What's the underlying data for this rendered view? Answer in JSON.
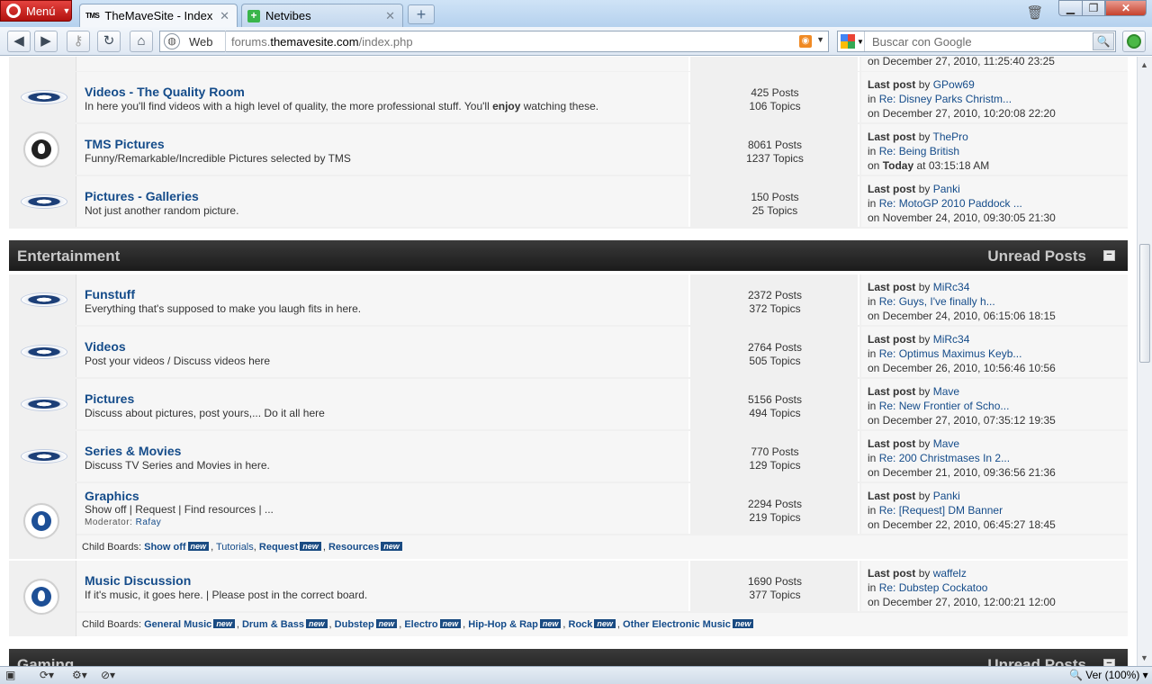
{
  "browser": {
    "menu_label": "Menú",
    "tabs": [
      {
        "title": "TheMaveSite - Index",
        "favicon": "TMS"
      },
      {
        "title": "Netvibes",
        "favicon": "+"
      }
    ],
    "address": {
      "mode_label": "Web",
      "url_prefix": "forums.",
      "url_domain": "themavesite.com",
      "url_path": "/index.php"
    },
    "search": {
      "placeholder": "Buscar con Google"
    },
    "status": {
      "zoom": "Ver (100%)"
    }
  },
  "top_partial_last": "on December 27, 2010, 11:25:40 23:25",
  "boards_media": [
    {
      "icon": "eye",
      "title": "Videos - The Quality Room",
      "desc_pre": "In here you'll find videos with a high level of quality, the more professional stuff. You'll ",
      "desc_bold": "enjoy",
      "desc_post": " watching these.",
      "posts": "425 Posts",
      "topics": "106 Topics",
      "by": "GPow69",
      "in": "Re: Disney Parks Christm...",
      "on": "on December 27, 2010, 10:20:08 22:20"
    },
    {
      "icon": "flame",
      "title": "TMS Pictures",
      "desc": "Funny/Remarkable/Incredible Pictures selected by TMS",
      "posts": "8061 Posts",
      "topics": "1237 Topics",
      "by": "ThePro",
      "in": "Re: Being British",
      "on_pre": "on ",
      "on_bold": "Today",
      "on_post": " at 03:15:18 AM"
    },
    {
      "icon": "eye",
      "title": "Pictures - Galleries",
      "desc": "Not just another random picture.",
      "posts": "150 Posts",
      "topics": "25 Topics",
      "by": "Panki",
      "in": "Re: MotoGP 2010 Paddock ...",
      "on": "on November 24, 2010, 09:30:05 21:30"
    }
  ],
  "category_entertainment": {
    "title": "Entertainment",
    "unread": "Unread Posts",
    "collapse": "−"
  },
  "boards_ent": [
    {
      "title": "Funstuff",
      "desc": "Everything that's supposed to make you laugh fits in here.",
      "posts": "2372 Posts",
      "topics": "372 Topics",
      "by": "MiRc34",
      "in": "Re: Guys, I've finally h...",
      "on": "on December 24, 2010, 06:15:06 18:15"
    },
    {
      "title": "Videos",
      "desc": "Post your videos / Discuss videos here",
      "posts": "2764 Posts",
      "topics": "505 Topics",
      "by": "MiRc34",
      "in": "Re: Optimus Maximus Keyb...",
      "on": "on December 26, 2010, 10:56:46 10:56"
    },
    {
      "title": "Pictures",
      "desc": "Discuss about pictures, post yours,... Do it all here",
      "posts": "5156 Posts",
      "topics": "494 Topics",
      "by": "Mave",
      "in": "Re: New Frontier of Scho...",
      "on": "on December 27, 2010, 07:35:12 19:35"
    },
    {
      "title": "Series & Movies",
      "desc": "Discuss TV Series and Movies in here.",
      "posts": "770 Posts",
      "topics": "129 Topics",
      "by": "Mave",
      "in": "Re: 200 Christmases In 2...",
      "on": "on December 21, 2010, 09:36:56 21:36"
    }
  ],
  "graphics": {
    "title": "Graphics",
    "desc": "Show off | Request | Find resources | ...",
    "mod_label": "Moderator:",
    "mod": "Rafay",
    "posts": "2294 Posts",
    "topics": "219 Topics",
    "by": "Panki",
    "in": "Re: [Request] DM Banner",
    "on": "on December 22, 2010, 06:45:27 18:45",
    "child_label": "Child Boards:",
    "children": [
      "Show off",
      "Tutorials",
      "Request",
      "Resources"
    ]
  },
  "music": {
    "title": "Music Discussion",
    "desc": "If it's music, it goes here. | Please post in the correct board.",
    "posts": "1690 Posts",
    "topics": "377 Topics",
    "by": "waffelz",
    "in": "Re: Dubstep Cockatoo",
    "on": "on December 27, 2010, 12:00:21 12:00",
    "child_label": "Child Boards:",
    "children": [
      "General Music",
      "Drum & Bass",
      "Dubstep",
      "Electro",
      "Hip-Hop & Rap",
      "Rock",
      "Other Electronic Music"
    ]
  },
  "labels": {
    "last_post": "Last post",
    "by": "by",
    "in": "in",
    "new": "new"
  },
  "category_gaming": {
    "title": "Gaming",
    "unread": "Unread Posts"
  }
}
